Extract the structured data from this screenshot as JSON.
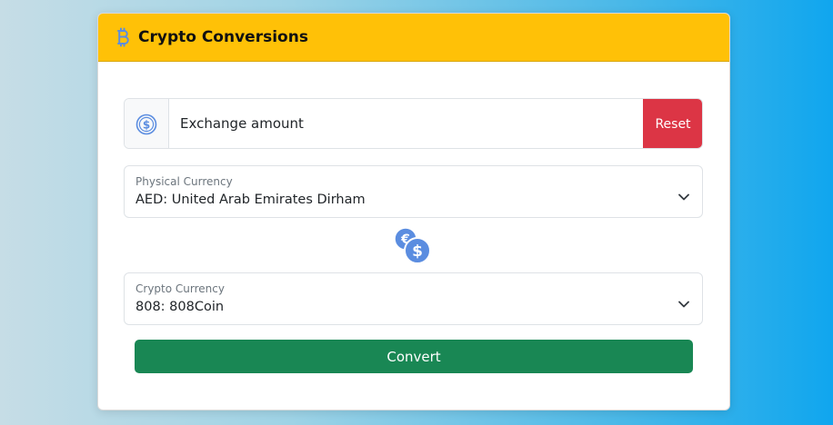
{
  "header": {
    "title": "Crypto Conversions",
    "icon": "bitcoin-icon"
  },
  "amount": {
    "placeholder": "Exchange amount",
    "value": "",
    "icon": "dollar-coin-icon",
    "reset_label": "Reset"
  },
  "physical_currency": {
    "label": "Physical Currency",
    "selected": "AED: United Arab Emirates Dirham"
  },
  "exchange_icon": "currency-exchange-icon",
  "crypto_currency": {
    "label": "Crypto Currency",
    "selected": "808: 808Coin"
  },
  "convert_label": "Convert",
  "colors": {
    "header": "#ffc107",
    "reset": "#dc3545",
    "convert": "#198754",
    "icon_blue": "#5b8de0"
  }
}
